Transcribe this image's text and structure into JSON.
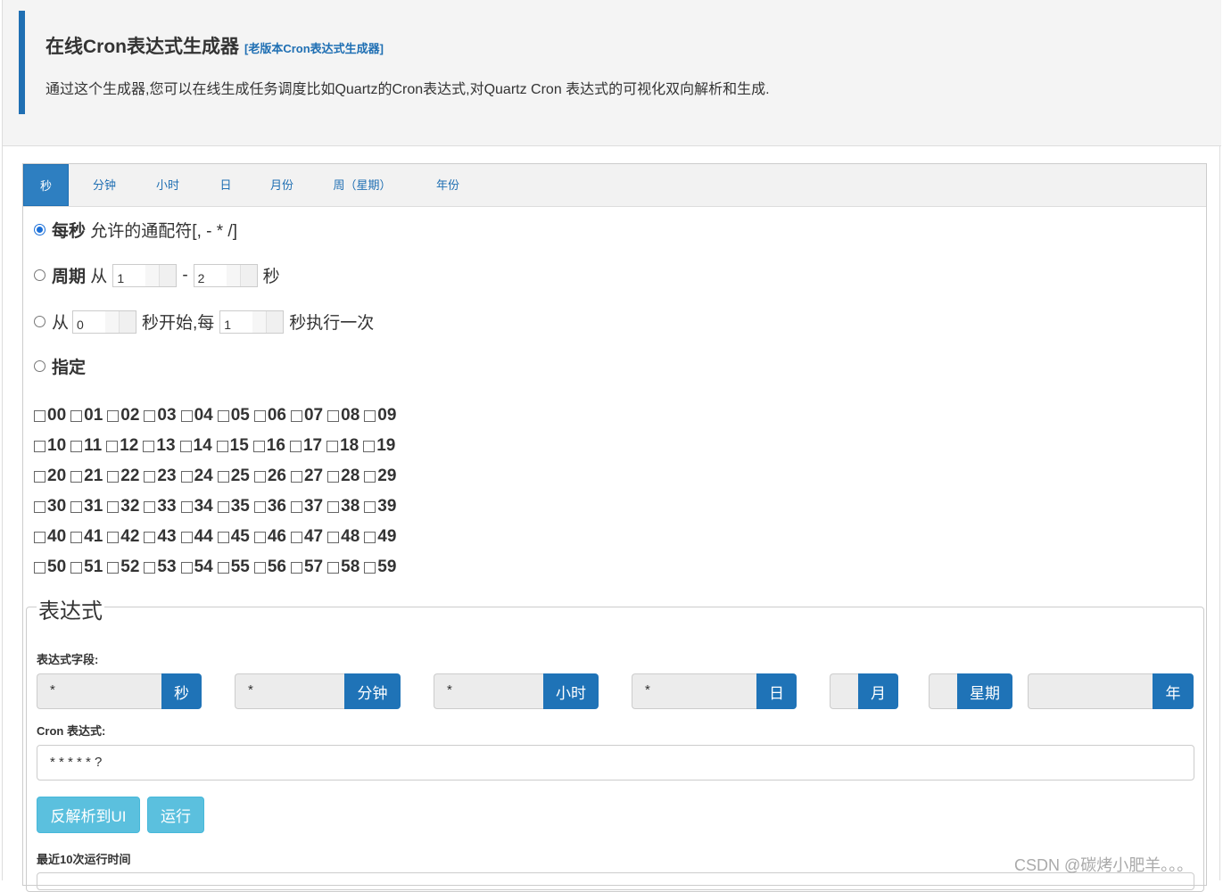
{
  "header": {
    "title": "在线Cron表达式生成器",
    "old_version_link": "[老版本Cron表达式生成器]",
    "description": "通过这个生成器,您可以在线生成任务调度比如Quartz的Cron表达式,对Quartz Cron 表达式的可视化双向解析和生成."
  },
  "tabs": [
    "秒",
    "分钟",
    "小时",
    "日",
    "月份",
    "周（星期）",
    "年份"
  ],
  "active_tab": "秒",
  "options": {
    "every": {
      "label": "每秒",
      "text": "允许的通配符[, - * /]"
    },
    "period": {
      "label": "周期",
      "from": "从",
      "dash": "-",
      "unit": "秒",
      "start": "1",
      "end": "2"
    },
    "from_every": {
      "from": "从",
      "mid": "秒开始,每",
      "end": "秒执行一次",
      "start": "0",
      "step": "1"
    },
    "specify": {
      "label": "指定"
    }
  },
  "seconds_rows": [
    [
      "00",
      "01",
      "02",
      "03",
      "04",
      "05",
      "06",
      "07",
      "08",
      "09"
    ],
    [
      "10",
      "11",
      "12",
      "13",
      "14",
      "15",
      "16",
      "17",
      "18",
      "19"
    ],
    [
      "20",
      "21",
      "22",
      "23",
      "24",
      "25",
      "26",
      "27",
      "28",
      "29"
    ],
    [
      "30",
      "31",
      "32",
      "33",
      "34",
      "35",
      "36",
      "37",
      "38",
      "39"
    ],
    [
      "40",
      "41",
      "42",
      "43",
      "44",
      "45",
      "46",
      "47",
      "48",
      "49"
    ],
    [
      "50",
      "51",
      "52",
      "53",
      "54",
      "55",
      "56",
      "57",
      "58",
      "59"
    ]
  ],
  "expression": {
    "legend": "表达式",
    "fields_label": "表达式字段:",
    "fields": [
      {
        "value": "*",
        "addon": "秒"
      },
      {
        "value": "*",
        "addon": "分钟"
      },
      {
        "value": "*",
        "addon": "小时"
      },
      {
        "value": "*",
        "addon": "日"
      },
      {
        "value": "",
        "addon": "月"
      },
      {
        "value": "",
        "addon": "星期"
      },
      {
        "value": "",
        "addon": "年"
      }
    ],
    "cron_label": "Cron 表达式:",
    "cron_value": "* * * * * ?",
    "reverse_button": "反解析到UI",
    "run_button": "运行",
    "recent_label": "最近10次运行时间"
  },
  "watermark": "CSDN @碳烤小肥羊。。。"
}
